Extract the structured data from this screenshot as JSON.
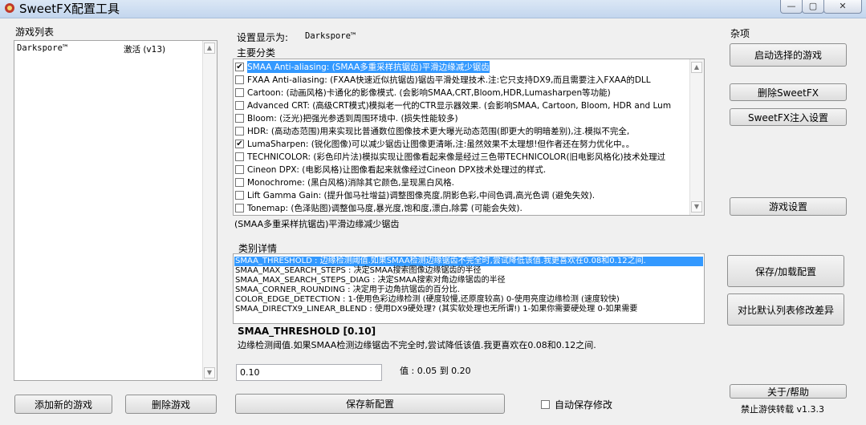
{
  "window": {
    "title": "SweetFX配置工具",
    "controls": [
      "—",
      "▢",
      "✕"
    ]
  },
  "game_list": {
    "label": "游戏列表",
    "items": [
      {
        "name": "Darkspore™",
        "status": "激活 (v13)"
      }
    ],
    "add_button": "添加新的游戏",
    "remove_button": "删除游戏"
  },
  "settings": {
    "display_label": "设置显示为:",
    "display_value": "Darkspore™",
    "categories_label": "主要分类",
    "categories": [
      {
        "text": "SMAA Anti-aliasing: (SMAA多重采样抗锯齿)平滑边缘减少锯齿",
        "checked": true,
        "selected": true
      },
      {
        "text": "FXAA Anti-aliasing: (FXAA快速近似抗锯齿)锯齿平滑处理技术.注:它只支持DX9,而且需要注入FXAA的DLL",
        "checked": false,
        "selected": false
      },
      {
        "text": "Cartoon: (动画风格)卡通化的影像模式. (会影响SMAA,CRT,Bloom,HDR,Lumasharpen等功能)",
        "checked": false,
        "selected": false
      },
      {
        "text": "Advanced CRT: (高级CRT模式)模拟老一代的CTR显示器效果. (会影响SMAA, Cartoon, Bloom, HDR and Lum",
        "checked": false,
        "selected": false
      },
      {
        "text": "Bloom: (泛光)把强光参透到周围环境中. (损失性能较多)",
        "checked": false,
        "selected": false
      },
      {
        "text": "HDR: (高动态范围)用来实现比普通数位图像技术更大曝光动态范围(即更大的明暗差别),注.模拟不完全,",
        "checked": false,
        "selected": false
      },
      {
        "text": "LumaSharpen: (锐化图像)可以减少锯齿让图像更清晰,注:虽然效果不太理想!但作者还在努力优化中。。",
        "checked": true,
        "selected": false
      },
      {
        "text": "TECHNICOLOR: (彩色印片法)模拟实现让图像看起来像是经过三色带TECHNICOLOR(旧电影风格化)技术处理过",
        "checked": false,
        "selected": false
      },
      {
        "text": "Cineon DPX: (电影风格)让图像看起来就像经过Cineon DPX技术处理过的样式.",
        "checked": false,
        "selected": false
      },
      {
        "text": "Monochrome: (黑白风格)消除其它颜色,呈现黑白风格.",
        "checked": false,
        "selected": false
      },
      {
        "text": "Lift Gamma Gain: (提升伽马社增益)调整图像亮度,阴影色彩,中间色调,高光色调 (避免失效).",
        "checked": false,
        "selected": false
      },
      {
        "text": "Tonemap: (色泽贴图)调整伽马度,暴光度,饱和度,漂白,除雾 (可能会失效).",
        "checked": false,
        "selected": false
      }
    ],
    "category_description": "(SMAA多重采样抗锯齿)平滑边缘减少锯齿",
    "details_label": "类别详情",
    "details": [
      {
        "text": "SMAA_THRESHOLD : 边缘检测阈值.如果SMAA检测边缘锯齿不完全时,尝试降低该值.我更喜欢在0.08和0.12之间.",
        "selected": true
      },
      {
        "text": "SMAA_MAX_SEARCH_STEPS : 决定SMAA搜索图像边缘锯齿的半径",
        "selected": false
      },
      {
        "text": "SMAA_MAX_SEARCH_STEPS_DIAG : 决定SMAA搜索对角边缘锯齿的半径",
        "selected": false
      },
      {
        "text": "SMAA_CORNER_ROUNDING : 决定用于边角抗锯齿的百分比.",
        "selected": false
      },
      {
        "text": "COLOR_EDGE_DETECTION : 1-使用色彩边缘检测 (硬度较慢,还原度较高) 0-使用亮度边缘检测 (速度较快)",
        "selected": false
      },
      {
        "text": "SMAA_DIRECTX9_LINEAR_BLEND : 使用DX9硬处理? (其实软处理也无所谓!) 1-如果你需要硬处理  0-如果需要",
        "selected": false
      }
    ],
    "param_name": "SMAA_THRESHOLD [0.10]",
    "param_description": "边缘检测阈值.如果SMAA检测边缘锯齿不完全时,尝试降低该值.我更喜欢在0.08和0.12之间.",
    "param_value": "0.10",
    "range_label": "值 : 0.05 到 0.20",
    "save_button": "保存新配置",
    "autosave_label": "自动保存修改",
    "autosave_checked": false
  },
  "misc": {
    "label": "杂项",
    "launch_button": "启动选择的游戏",
    "delete_sweetfx_button": "删除SweetFX",
    "inject_settings_button": "SweetFX注入设置",
    "game_settings_button": "游戏设置",
    "save_load_button": "保存/加载配置",
    "compare_button": "对比默认列表修改差异",
    "about_button": "关于/帮助",
    "version_text": "禁止游侠转载 v1.3.3"
  },
  "colors": {
    "selection": "#3399ff",
    "window_bg": "#f0f0f0"
  }
}
